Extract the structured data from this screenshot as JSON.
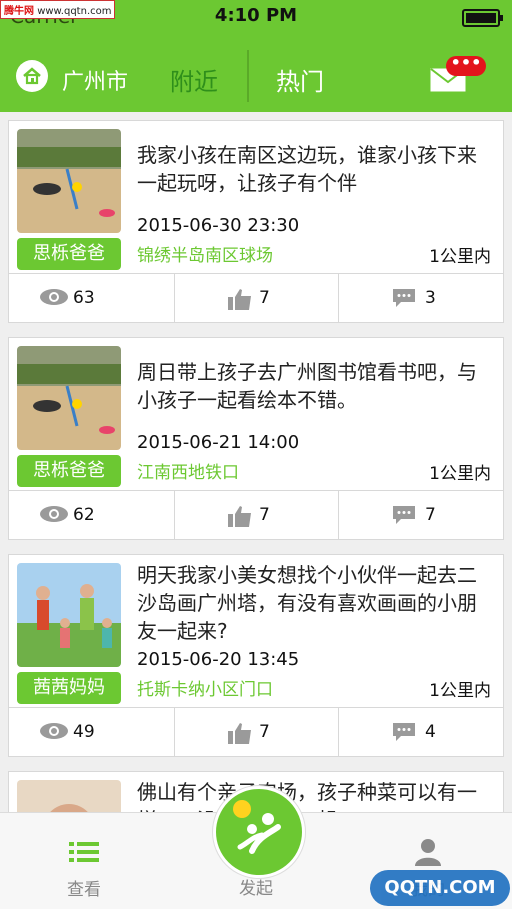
{
  "status": {
    "carrier": "Carrier",
    "time": "4:10 PM"
  },
  "watermark": {
    "brand": "腾牛网",
    "url": "www.qqtn.com"
  },
  "header": {
    "city": "广州市",
    "tabs": [
      {
        "label": "附近",
        "active": true
      },
      {
        "label": "热门",
        "active": false
      }
    ],
    "mail_badge": "•••"
  },
  "posts": [
    {
      "author": "思栎爸爸",
      "content": "我家小孩在南区这边玩，谁家小孩下来一起玩呀，让孩子有个伴",
      "datetime": "2015-06-30 23:30",
      "location": "锦绣半岛南区球场",
      "distance": "1公里内",
      "views": "63",
      "likes": "7",
      "comments": "3"
    },
    {
      "author": "思栎爸爸",
      "content": "周日带上孩子去广州图书馆看书吧，与小孩子一起看绘本不错。",
      "datetime": "2015-06-21 14:00",
      "location": "江南西地铁口",
      "distance": "1公里内",
      "views": "62",
      "likes": "7",
      "comments": "7"
    },
    {
      "author": "茜茜妈妈",
      "content": "明天我家小美女想找个小伙伴一起去二沙岛画广州塔，有没有喜欢画画的小朋友一起来?",
      "datetime": "2015-06-20 13:45",
      "location": "托斯卡纳小区门口",
      "distance": "1公里内",
      "views": "49",
      "likes": "7",
      "comments": "4"
    },
    {
      "content": "佛山有个亲子农场，孩子种菜可以有一样……没有大厘亲一起"
    }
  ],
  "tabbar": {
    "view": "查看",
    "launch": "发起",
    "me": "我的"
  },
  "corner_watermark": "QQTN.COM",
  "colors": {
    "brand_green": "#6cc832",
    "active_tab": "#2f8f1b",
    "badge_red": "#e3141c"
  }
}
